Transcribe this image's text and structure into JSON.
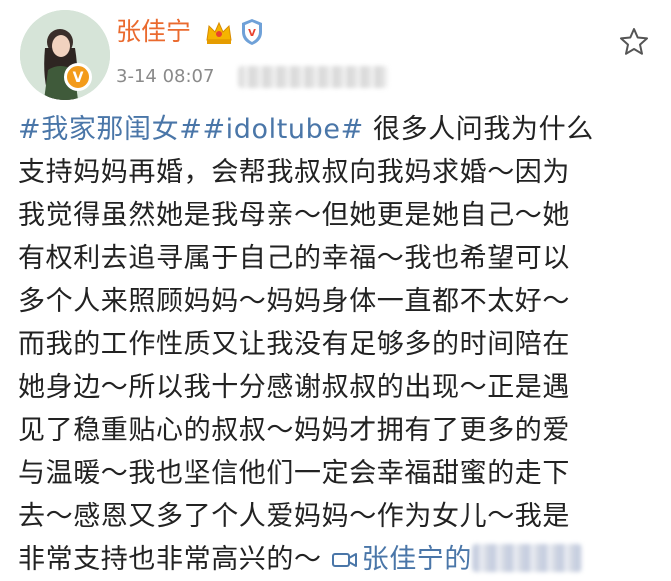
{
  "post": {
    "author": "张佳宁",
    "timestamp": "3-14 08:07",
    "hashtags": [
      "#我家那闺女#",
      "#idoltube#"
    ],
    "lines": [
      "很多人问我为什么",
      "支持妈妈再婚，会帮我叔叔向我妈求婚～因为",
      "我觉得虽然她是我母亲～但她更是她自己～她",
      "有权利去追寻属于自己的幸福～我也希望可以",
      "多个人来照顾妈妈～妈妈身体一直都不太好～",
      "而我的工作性质又让我没有足够多的时间陪在",
      "她身边～所以我十分感谢叔叔的出现～正是遇",
      "见了稳重贴心的叔叔～妈妈才拥有了更多的爱",
      "与温暖～我也坚信他们一定会幸福甜蜜的走下",
      "去～感恩又多了个人爱妈妈～作为女儿～我是",
      "非常支持也非常高兴的～"
    ],
    "video_link": "张佳宁的"
  },
  "icons": {
    "crown": "crown-icon",
    "shield": "shield-icon",
    "star": "star-icon",
    "video": "video-camera-icon",
    "verified": "verified-badge-icon"
  },
  "colors": {
    "author": "#ea6a2e",
    "hashtag": "#4a76a8",
    "text": "#222222",
    "timestamp": "#8a8a8a",
    "verified": "#f39b1a"
  }
}
